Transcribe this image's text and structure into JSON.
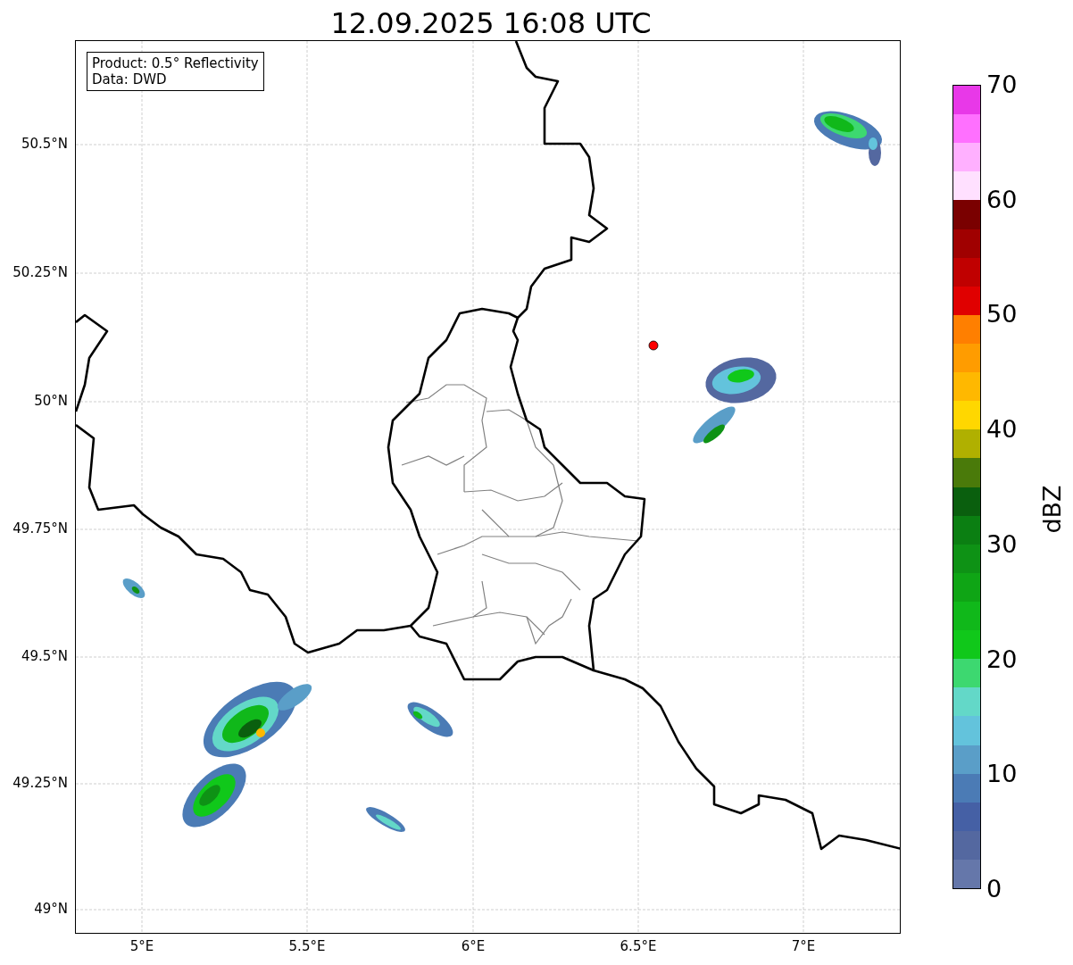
{
  "title": "12.09.2025 16:08 UTC",
  "map": {
    "info_box": [
      "Product: 0.5° Reflectivity",
      "Data: DWD"
    ],
    "y_ticks": [
      "50.5°N",
      "50.25°N",
      "50°N",
      "49.75°N",
      "49.5°N",
      "49.25°N",
      "49°N"
    ],
    "x_ticks": [
      "5°E",
      "5.5°E",
      "6°E",
      "6.5°E",
      "7°E"
    ]
  },
  "colorbar": {
    "label": "dBZ",
    "ticks": [
      "70",
      "60",
      "50",
      "40",
      "30",
      "20",
      "10",
      "0"
    ],
    "bins": [
      {
        "color": "#6577aa"
      },
      {
        "color": "#5468a0"
      },
      {
        "color": "#4560a5"
      },
      {
        "color": "#4b7bb5"
      },
      {
        "color": "#5a9ec8"
      },
      {
        "color": "#63c3dc"
      },
      {
        "color": "#63d8c8"
      },
      {
        "color": "#3dd870"
      },
      {
        "color": "#10c81a"
      },
      {
        "color": "#10b81a"
      },
      {
        "color": "#0fa515"
      },
      {
        "color": "#0e9215"
      },
      {
        "color": "#0b7f12"
      },
      {
        "color": "#0a5f0e"
      },
      {
        "color": "#4a7a0a"
      },
      {
        "color": "#b0b000"
      },
      {
        "color": "#ffd700"
      },
      {
        "color": "#ffb800"
      },
      {
        "color": "#ff9c00"
      },
      {
        "color": "#ff7f00"
      },
      {
        "color": "#e00000"
      },
      {
        "color": "#c00000"
      },
      {
        "color": "#a00000"
      },
      {
        "color": "#7a0000"
      },
      {
        "color": "#ffe0ff"
      },
      {
        "color": "#ffb0ff"
      },
      {
        "color": "#ff70ff"
      },
      {
        "color": "#e838e8"
      }
    ]
  }
}
